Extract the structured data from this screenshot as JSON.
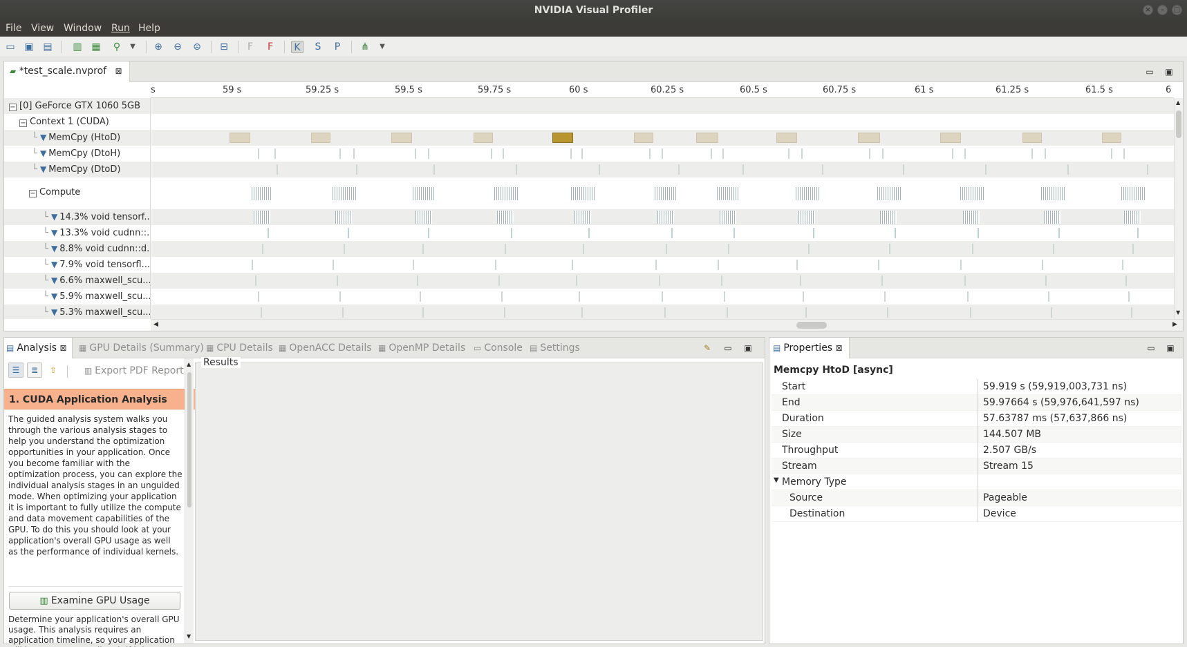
{
  "window": {
    "title": "NVIDIA Visual Profiler"
  },
  "menu": [
    "File",
    "View",
    "Window",
    "Run",
    "Help"
  ],
  "editor": {
    "tab_label": "*test_scale.nvprof",
    "ruler_ticks": [
      "s",
      "59 s",
      "59.25 s",
      "59.5 s",
      "59.75 s",
      "60 s",
      "60.25 s",
      "60.5 s",
      "60.75 s",
      "61 s",
      "61.25 s",
      "61.5 s",
      "6"
    ],
    "rows": [
      {
        "label": "[0] GeForce GTX 1060 5GB"
      },
      {
        "label": "Context 1 (CUDA)"
      },
      {
        "label": "MemCpy (HtoD)"
      },
      {
        "label": "MemCpy (DtoH)"
      },
      {
        "label": "MemCpy (DtoD)"
      },
      {
        "label": "Compute"
      },
      {
        "label": "14.3% void tensorf..."
      },
      {
        "label": "13.3% void cudnn::..."
      },
      {
        "label": "8.8% void cudnn::d..."
      },
      {
        "label": "7.9% void tensorfl..."
      },
      {
        "label": "6.6% maxwell_scu..."
      },
      {
        "label": "5.9% maxwell_scu..."
      },
      {
        "label": "5.3% maxwell_scu..."
      }
    ]
  },
  "analysis": {
    "tabs": [
      {
        "label": "Analysis"
      },
      {
        "label": "GPU Details (Summary)"
      },
      {
        "label": "CPU Details"
      },
      {
        "label": "OpenACC Details"
      },
      {
        "label": "OpenMP Details"
      },
      {
        "label": "Console"
      },
      {
        "label": "Settings"
      }
    ],
    "export_pdf": "Export PDF Report",
    "section_title": "1. CUDA Application Analysis",
    "intro_text": "The guided analysis system walks you through the various analysis stages to help you understand the optimization opportunities in your application. Once you become familiar with the optimization process, you can explore the individual analysis stages in an unguided mode. When optimizing your application it is important to fully utilize the compute and data movement capabilities of the GPU. To do this you should look at your application's overall GPU usage as well as the performance of individual kernels.",
    "examine_button": "Examine GPU Usage",
    "examine_text": "Determine your application's overall GPU usage. This analysis requires an application timeline, so your application will be run once to collect it if it is not already available.",
    "results_label": "Results"
  },
  "properties": {
    "tab_label": "Properties",
    "title": "Memcpy HtoD [async]",
    "rows": [
      {
        "key": "Start",
        "value": "59.919 s (59,919,003,731 ns)"
      },
      {
        "key": "End",
        "value": "59.97664 s (59,976,641,597 ns)"
      },
      {
        "key": "Duration",
        "value": "57.63787 ms (57,637,866 ns)"
      },
      {
        "key": "Size",
        "value": "144.507 MB"
      },
      {
        "key": "Throughput",
        "value": "2.507 GB/s"
      },
      {
        "key": "Stream",
        "value": "Stream 15"
      },
      {
        "key": "Memory Type",
        "value": ""
      },
      {
        "key": "Source",
        "value": "Pageable"
      },
      {
        "key": "Destination",
        "value": "Device"
      }
    ]
  },
  "colors": {
    "section_header": "#f8b18d",
    "selected_memcpy": "#b8952e",
    "memcpy": "#ddd4c0"
  }
}
